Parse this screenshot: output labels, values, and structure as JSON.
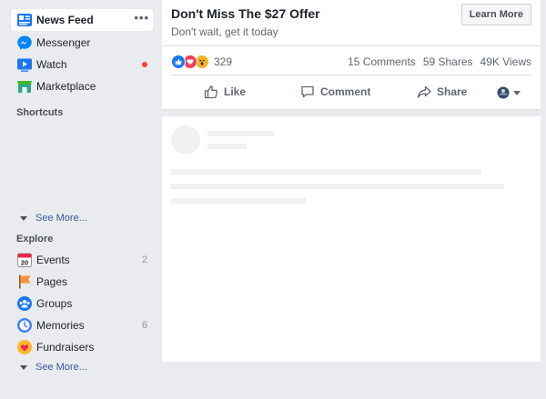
{
  "sidebar": {
    "main_items": [
      {
        "label": "News Feed",
        "icon": "news-feed-icon"
      },
      {
        "label": "Messenger",
        "icon": "messenger-icon"
      },
      {
        "label": "Watch",
        "icon": "watch-icon"
      },
      {
        "label": "Marketplace",
        "icon": "marketplace-icon"
      }
    ],
    "news_feed_options": "•••",
    "shortcuts_title": "Shortcuts",
    "shortcuts_see_more": "See More...",
    "explore_title": "Explore",
    "explore_items": [
      {
        "label": "Events",
        "count": "2",
        "icon": "events-icon"
      },
      {
        "label": "Pages",
        "count": "",
        "icon": "pages-flag-icon"
      },
      {
        "label": "Groups",
        "count": "",
        "icon": "groups-icon"
      },
      {
        "label": "Memories",
        "count": "6",
        "icon": "memories-icon"
      },
      {
        "label": "Fundraisers",
        "count": "",
        "icon": "fundraisers-icon"
      }
    ],
    "explore_see_more": "See More...",
    "events_date": "20"
  },
  "post": {
    "title": "Don't Miss The $27 Offer",
    "subtitle": "Don't wait, get it today",
    "cta": "Learn More",
    "reaction_count": "329",
    "comments": "15 Comments",
    "shares": "59 Shares",
    "views": "49K Views",
    "actions": {
      "like": "Like",
      "comment": "Comment",
      "share": "Share"
    }
  },
  "colors": {
    "background": "#e9ebee",
    "link": "#385898",
    "like_blue": "#1877f2",
    "love_red": "#f33e58",
    "wow_yellow": "#f7b125",
    "notification_dot": "#fa3e3e"
  }
}
